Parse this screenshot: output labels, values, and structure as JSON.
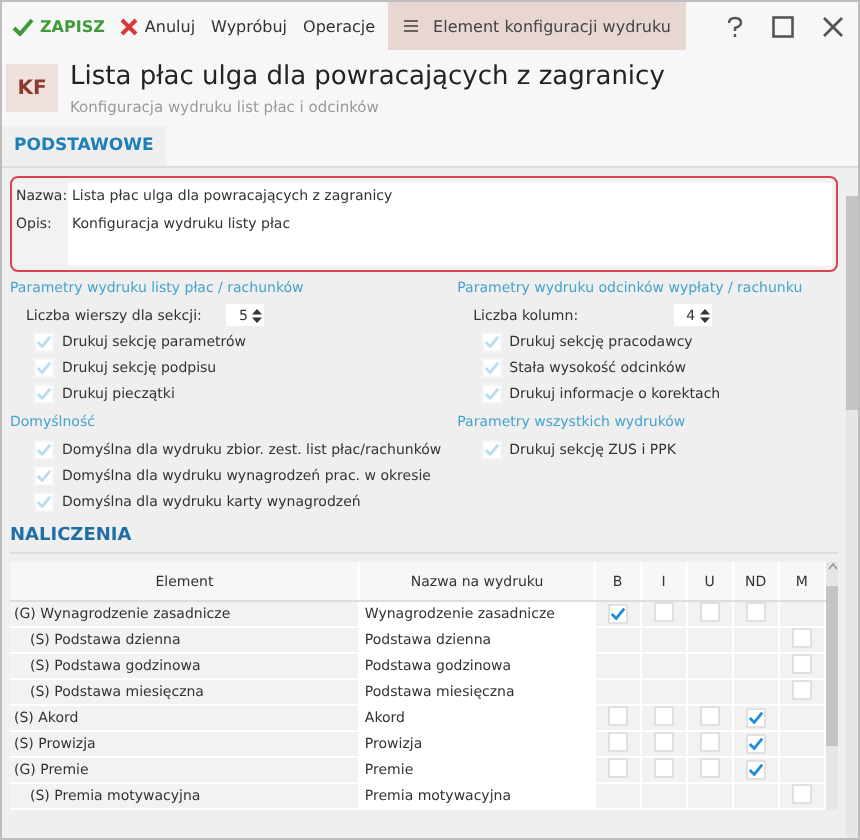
{
  "toolbar": {
    "buttons": [
      {
        "label": "ZAPISZ",
        "kind": "save"
      },
      {
        "label": "Anuluj",
        "kind": "cancel"
      },
      {
        "label": "Wypróbuj",
        "kind": "plain"
      },
      {
        "label": "Operacje",
        "kind": "plain"
      }
    ],
    "context_tab": {
      "label": "Element konfiguracji wydruku"
    }
  },
  "header": {
    "badge": "KF",
    "title": "Lista płac ulga dla powracających z zagranicy",
    "subtitle": "Konfiguracja wydruku list płac i odcinków"
  },
  "tabs": [
    {
      "label": "PODSTAWOWE",
      "selected": true
    }
  ],
  "form": {
    "name_label": "Nazwa:",
    "name_value": "Lista płac ulga dla powracających z zagranicy",
    "desc_label": "Opis:",
    "desc_value": "Konfiguracja wydruku listy płac"
  },
  "sections": [
    {
      "title": "Parametry wydruku listy płac / rachunków",
      "spinner": {
        "label": "Liczba wierszy dla sekcji:",
        "value": "5"
      },
      "checks": [
        {
          "label": "Drukuj sekcję parametrów",
          "checked": true
        },
        {
          "label": "Drukuj sekcję podpisu",
          "checked": true
        },
        {
          "label": "Drukuj pieczątki",
          "checked": true
        }
      ]
    },
    {
      "title": "Parametry wydruku odcinków wypłaty / rachunku",
      "spinner": {
        "label": "Liczba kolumn:",
        "value": "4"
      },
      "checks": [
        {
          "label": "Drukuj sekcję pracodawcy",
          "checked": true
        },
        {
          "label": "Stała wysokość odcinków",
          "checked": true
        },
        {
          "label": "Drukuj informacje o korektach",
          "checked": true
        }
      ]
    },
    {
      "title": "Domyślność",
      "checks": [
        {
          "label": "Domyślna dla wydruku zbior. zest. list płac/rachunków",
          "checked": true
        },
        {
          "label": "Domyślna dla wydruku wynagrodzeń prac. w okresie",
          "checked": true
        },
        {
          "label": "Domyślna dla wydruku karty wynagrodzeń",
          "checked": true
        }
      ]
    },
    {
      "title": "Parametry wszystkich wydruków",
      "checks": [
        {
          "label": "Drukuj sekcję ZUS i PPK",
          "checked": true
        }
      ]
    }
  ],
  "naliczenia": {
    "title": "NALICZENIA",
    "columns": [
      "Element",
      "Nazwa na wydruku",
      "B",
      "I",
      "U",
      "ND",
      "M"
    ],
    "rows": [
      {
        "element": "(G) Wynagrodzenie zasadnicze",
        "print_name": "Wynagrodzenie zasadnicze",
        "b": true,
        "i": false,
        "u": false,
        "nd": false,
        "children": [
          {
            "element": "(S) Podstawa dzienna",
            "print_name": "Podstawa dzienna",
            "m": false
          },
          {
            "element": "(S) Podstawa godzinowa",
            "print_name": "Podstawa godzinowa",
            "m": false
          },
          {
            "element": "(S) Podstawa miesięczna",
            "print_name": "Podstawa miesięczna",
            "m": false
          }
        ]
      },
      {
        "element": "(S) Akord",
        "print_name": "Akord",
        "b": false,
        "i": false,
        "u": false,
        "nd": true
      },
      {
        "element": "(S) Prowizja",
        "print_name": "Prowizja",
        "b": false,
        "i": false,
        "u": false,
        "nd": true
      },
      {
        "element": "(G) Premie",
        "print_name": "Premie",
        "b": false,
        "i": false,
        "u": false,
        "nd": true,
        "children": [
          {
            "element": "(S) Premia motywacyjna",
            "print_name": "Premia motywacyjna",
            "m": false
          }
        ]
      }
    ]
  }
}
